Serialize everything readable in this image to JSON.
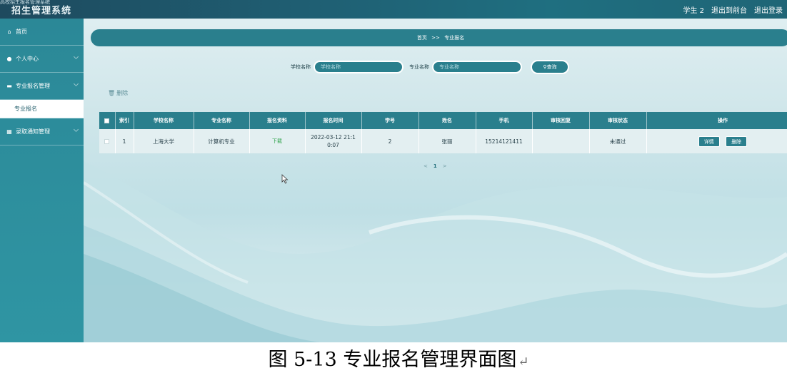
{
  "header": {
    "small_title": "高校招生报名管理系统",
    "title": "招生管理系统",
    "user": "学生 2",
    "back_link": "退出到前台",
    "logout_link": "退出登录"
  },
  "sidebar": {
    "items": [
      {
        "label": "首页",
        "icon": "home-icon"
      },
      {
        "label": "个人中心",
        "icon": "user-icon"
      },
      {
        "label": "专业报名管理",
        "icon": "briefcase-icon"
      },
      {
        "label": "录取通知管理",
        "icon": "grid-icon"
      }
    ],
    "sub_item": "专业报名"
  },
  "breadcrumb": {
    "home": "首页",
    "sep": ">>",
    "current": "专业报名"
  },
  "search": {
    "school_label": "学校名称",
    "school_placeholder": "学校名称",
    "major_label": "专业名称",
    "major_placeholder": "专业名称",
    "button": "查询"
  },
  "toolbar": {
    "delete_label": "删除"
  },
  "table": {
    "headers": [
      "索引",
      "学校名称",
      "专业名称",
      "报名资料",
      "报名时间",
      "学号",
      "姓名",
      "手机",
      "审核回复",
      "审核状态",
      "操作"
    ],
    "rows": [
      {
        "index": "1",
        "school": "上海大学",
        "major": "计算机专业",
        "material": "下载",
        "time_line1": "2022-03-12 21:1",
        "time_line2": "0:07",
        "student_no": "2",
        "name": "张丽",
        "phone": "15214121411",
        "reply": "",
        "status": "未通过",
        "detail_btn": "详情",
        "delete_btn": "删除"
      }
    ]
  },
  "pager": {
    "prev": "<",
    "page": "1",
    "next": ">"
  },
  "caption": {
    "text": "图 5-13 专业报名管理界面图"
  },
  "colors": {
    "primary": "#2a7f8d",
    "sidebar": "#2b8897",
    "download": "#2da24a"
  }
}
